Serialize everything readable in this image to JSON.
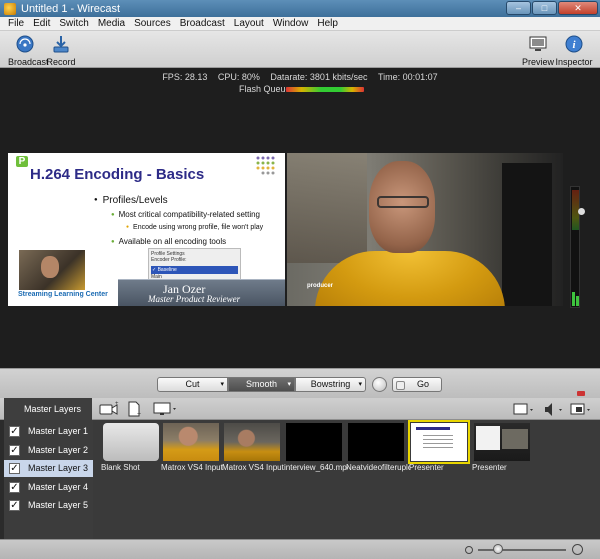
{
  "window": {
    "title": "Untitled 1 - Wirecast"
  },
  "menu": [
    "File",
    "Edit",
    "Switch",
    "Media",
    "Sources",
    "Broadcast",
    "Layout",
    "Window",
    "Help"
  ],
  "toolbar": {
    "broadcast_label": "Broadcast",
    "record_label": "Record",
    "preview_label": "Preview",
    "inspector_label": "Inspector"
  },
  "status": {
    "fps": "FPS: 28.13",
    "cpu": "CPU: 80%",
    "datarate": "Datarate: 3801 kbits/sec",
    "time": "Time: 00:01:07",
    "flash_queue": "Flash Queue:"
  },
  "slide": {
    "badge": "P",
    "title": "H.264 Encoding - Basics",
    "b1": "Profiles/Levels",
    "b2": "Most critical compatibility-related setting",
    "b3": "Encode using wrong profile, file won't play",
    "b4": "Available on all encoding tools",
    "profile_settings": "Profile Settings",
    "encoder_profile": "Encoder Profile:",
    "profile_selected": "✓ Baseline",
    "profile_main": "Main",
    "logo_text": "Streaming Learning Center",
    "name_line1": "Jan Ozer",
    "name_line2": "Master Product Reviewer",
    "cam_logo": "producer"
  },
  "transitions": {
    "cut": "Cut",
    "smooth": "Smooth",
    "bowstring": "Bowstring",
    "go": "Go"
  },
  "layers": {
    "header": "Master Layers",
    "items": [
      {
        "label": "Master Layer 1",
        "checked": "✓"
      },
      {
        "label": "Master Layer 2",
        "checked": "✓"
      },
      {
        "label": "Master Layer 3",
        "checked": "✓"
      },
      {
        "label": "Master Layer 4",
        "checked": "✓"
      },
      {
        "label": "Master Layer 5",
        "checked": "✓"
      }
    ]
  },
  "shots": [
    {
      "label": "Blank Shot"
    },
    {
      "label": "Matrox VS4 Input 1"
    },
    {
      "label": "Matrox VS4 Input 2"
    },
    {
      "label": "interview_640.mp4"
    },
    {
      "label": "Neatvideofilteruploac"
    },
    {
      "label": "Presenter"
    },
    {
      "label": "Presenter"
    }
  ],
  "colors": {
    "selected_shot": "#e9d600",
    "selected_layer": "#c9d6ea",
    "meter_green": "#3ec43e"
  }
}
